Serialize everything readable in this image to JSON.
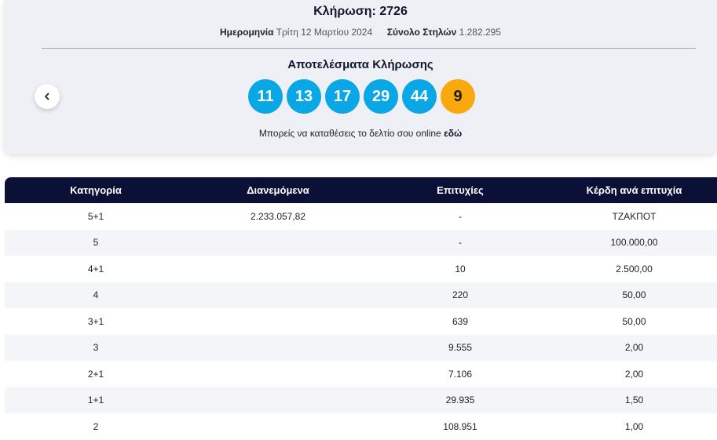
{
  "draw": {
    "title": "Κλήρωση: 2726",
    "date_label": "Ημερομηνία",
    "date_value": "Τρίτη 12 Μαρτίου 2024",
    "columns_label": "Σύνολο Στηλών",
    "columns_value": "1.282.295",
    "results_title": "Αποτελέσματα Κλήρωσης",
    "numbers": [
      "11",
      "13",
      "17",
      "29",
      "44"
    ],
    "joker": "9",
    "online_text": "Μπορείς να καταθέσεις το δελτίο σου online",
    "online_link": "εδώ"
  },
  "colors": {
    "ball_blue": "#0aa7e6",
    "joker_orange": "#f9a90d",
    "header_navy": "#0b1036"
  },
  "table": {
    "headers": [
      "Κατηγορία",
      "Διανεμόμενα",
      "Επιτυχίες",
      "Κέρδη ανά επιτυχία"
    ],
    "rows": [
      [
        "5+1",
        "2.233.057,82",
        "-",
        "ΤΖΑΚΠΟΤ"
      ],
      [
        "5",
        "",
        "-",
        "100.000,00"
      ],
      [
        "4+1",
        "",
        "10",
        "2.500,00"
      ],
      [
        "4",
        "",
        "220",
        "50,00"
      ],
      [
        "3+1",
        "",
        "639",
        "50,00"
      ],
      [
        "3",
        "",
        "9.555",
        "2,00"
      ],
      [
        "2+1",
        "",
        "7.106",
        "2,00"
      ],
      [
        "1+1",
        "",
        "29.935",
        "1,50"
      ],
      [
        "2",
        "",
        "108.951",
        "1,00"
      ]
    ]
  }
}
